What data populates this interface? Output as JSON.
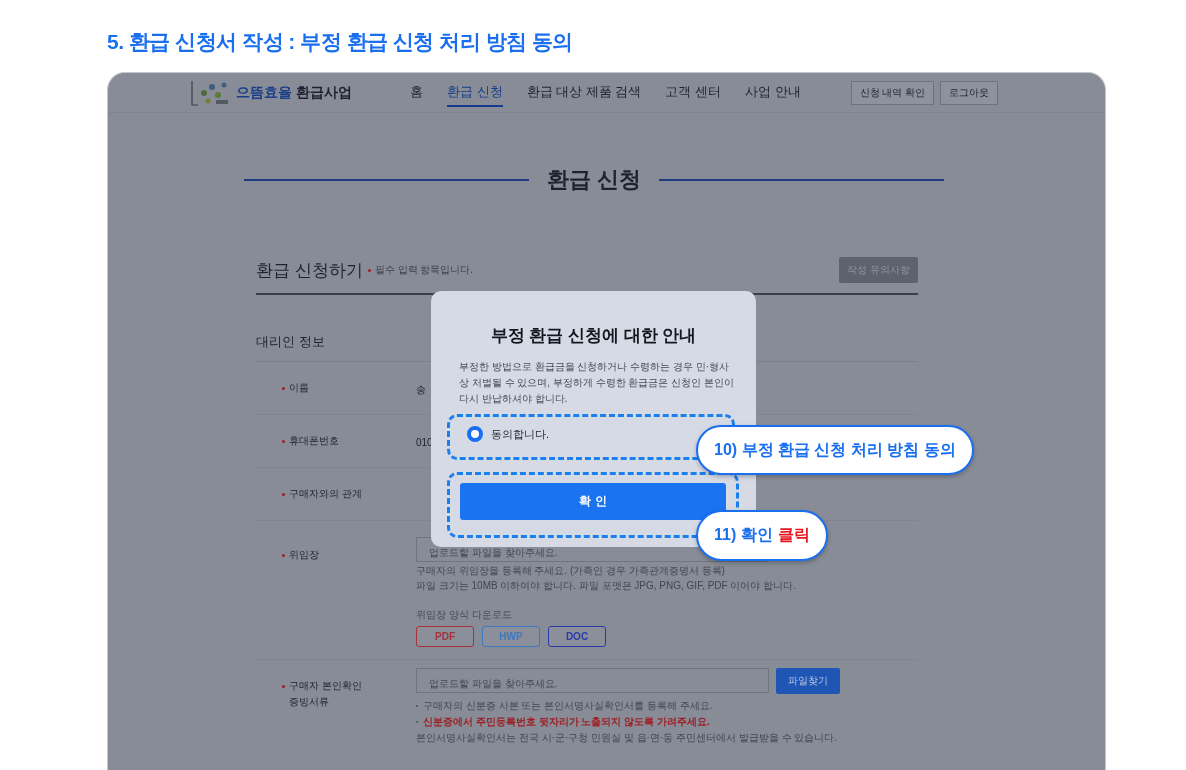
{
  "heading": "5. 환급 신청서 작성 : 부정 환급 신청 처리 방침 동의",
  "site": {
    "logo_light": "으뜸효율",
    "logo_bold": "환급사업",
    "nav": [
      {
        "label": "홈",
        "selected": false
      },
      {
        "label": "환급 신청",
        "selected": true
      },
      {
        "label": "환급 대상 제품 검색",
        "selected": false
      },
      {
        "label": "고객 센터",
        "selected": false
      },
      {
        "label": "사업 안내",
        "selected": false
      }
    ],
    "buttons": [
      "신청 내역 확인",
      "로그아웃"
    ]
  },
  "page_title": "환급 신청",
  "form": {
    "title": "환급 신청하기",
    "required_note": "필수 입력 항목입니다.",
    "notice_button": "작성 유의사항",
    "section": "대리인 정보",
    "rows": [
      {
        "kind": "text",
        "label": "이름",
        "value": "송"
      },
      {
        "kind": "text",
        "label": "휴대폰번호",
        "value": "010"
      },
      {
        "kind": "text",
        "label": "구매자와의 관계"
      },
      {
        "kind": "file",
        "label": "위임장",
        "placeholder": "업로드할 파일을 찾아주세요.",
        "help": [
          "구매자의 위임장을 등록해 주세요. (가족인 경우 가족관계증명서 등록)",
          "파일 크기는 10MB 이하여야 합니다. 파일 포맷은 JPG, PNG, GIF, PDF 이어야 합니다."
        ],
        "download_label": "위임장 양식 다운로드",
        "downloads": [
          {
            "label": "PDF",
            "color": "#a8323c"
          },
          {
            "label": "HWP",
            "color": "#3d78c0"
          },
          {
            "label": "DOC",
            "color": "#2a3aa6"
          }
        ]
      },
      {
        "kind": "upload",
        "label": "구매자 본인확인\n증빙서류",
        "placeholder": "업로드할 파일을 찾아주세요.",
        "button": "파일찾기",
        "notes": [
          {
            "text": "구매자의 신분증 사본 또는 본인서명사실확인서를 등록해 주세요.",
            "bullet": true,
            "warning": false
          },
          {
            "text": "신분증에서 주민등록번호 뒷자리가 노출되지 않도록 가려주세요.",
            "bullet": true,
            "warning": true
          },
          {
            "text": "본인서명사실확인서는 전국 시·군·구청 민원실 및 읍·면·동 주민센터에서 발급받을 수 있습니다.",
            "bullet": false,
            "warning": false
          }
        ]
      }
    ]
  },
  "modal": {
    "title": "부정 환급 신청에 대한 안내",
    "body": "부정한 방법으로 환급금을 신청하거나 수령하는 경우 민·형사상 처벌될 수 있으며, 부정하게 수령한 환급금은 신청인 본인이 다시 반납하셔야 합니다.",
    "agree": {
      "label": "동의합니다.",
      "selected": true
    },
    "confirm": "확 인"
  },
  "callouts": [
    {
      "text": "10) 부정 환급 신청 처리 방침 동의"
    },
    {
      "text": "11) 확인",
      "emphasis": "클릭"
    }
  ]
}
